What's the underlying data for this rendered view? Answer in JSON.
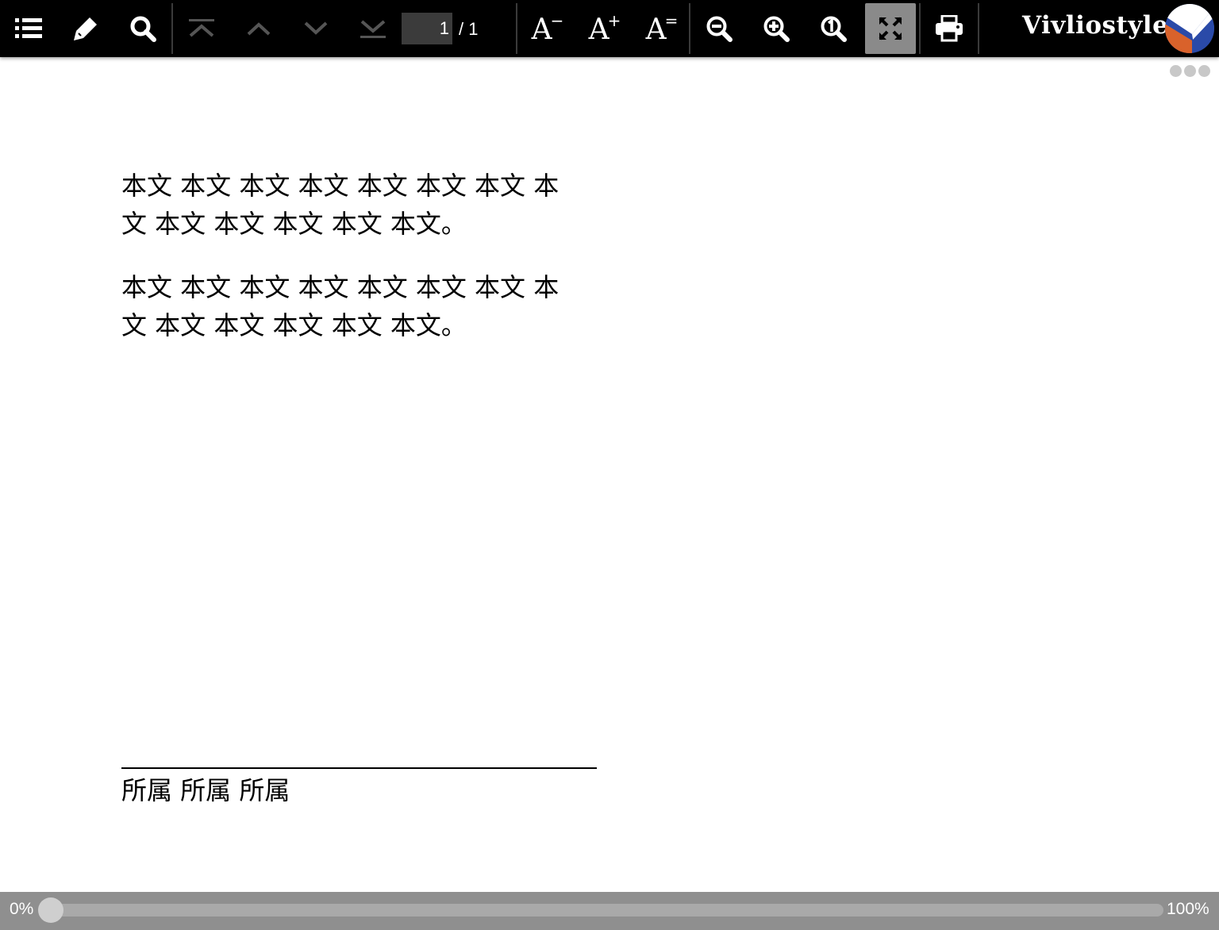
{
  "toolbar": {
    "buttons": [
      {
        "name": "toc-button",
        "icon": "list-icon"
      },
      {
        "name": "marker-button",
        "icon": "marker-pen-icon"
      },
      {
        "name": "search-button",
        "icon": "search-icon"
      },
      {
        "name": "first-page-button",
        "icon": "first-page-icon",
        "disabled": true
      },
      {
        "name": "previous-page-button",
        "icon": "chevron-up-icon",
        "disabled": true
      },
      {
        "name": "next-page-button",
        "icon": "chevron-down-icon",
        "disabled": true
      },
      {
        "name": "last-page-button",
        "icon": "last-page-icon",
        "disabled": true
      },
      {
        "name": "font-size-decrease-button",
        "icon": "font-decrease-icon"
      },
      {
        "name": "font-size-increase-button",
        "icon": "font-increase-icon"
      },
      {
        "name": "font-size-reset-button",
        "icon": "font-reset-icon"
      },
      {
        "name": "zoom-out-button",
        "icon": "zoom-out-icon"
      },
      {
        "name": "zoom-in-button",
        "icon": "zoom-in-icon"
      },
      {
        "name": "zoom-actual-size-button",
        "icon": "zoom-actual-icon"
      },
      {
        "name": "fit-to-screen-button",
        "icon": "fit-screen-icon",
        "active": true
      },
      {
        "name": "print-button",
        "icon": "printer-icon"
      }
    ],
    "font_label": "A",
    "font_decrease_sup": "−",
    "font_increase_sup": "+",
    "font_reset_sup": "=",
    "page_number": "1",
    "page_total": "/ 1",
    "brand": "Vivliostyle"
  },
  "document": {
    "paragraphs": [
      "本文 本文 本文 本文 本文 本文 本文 本文 本文 本文 本文 本文 本文。",
      "本文 本文 本文 本文 本文 本文 本文 本文 本文 本文 本文 本文 本文。"
    ],
    "affiliation": "所属 所属 所属"
  },
  "progress": {
    "start_label": "0%",
    "end_label": "100%",
    "value": 0
  },
  "colors": {
    "toolbar_bg": "#000000",
    "active_button_bg": "#8a8a8a",
    "progress_bar_bg": "#8f8f8f",
    "logo_blue": "#2a4aa8",
    "logo_orange": "#d9622b"
  }
}
